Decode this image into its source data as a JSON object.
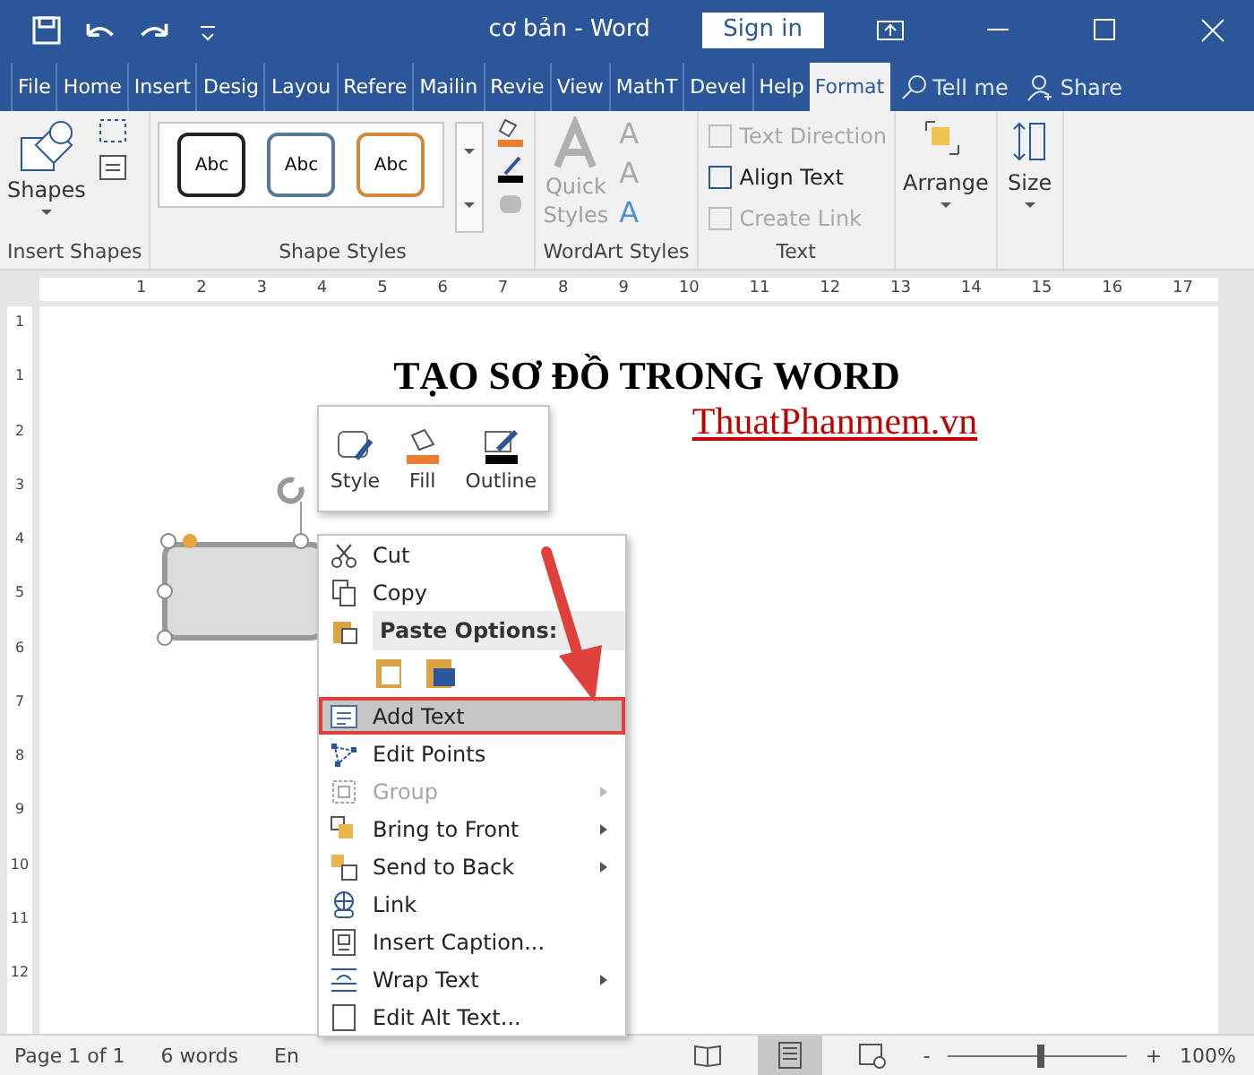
{
  "window": {
    "title": "cơ bản  -  Word",
    "sign_in": "Sign in"
  },
  "tabs": [
    {
      "label": "File",
      "selected": false
    },
    {
      "label": "Home",
      "selected": false
    },
    {
      "label": "Insert",
      "selected": false
    },
    {
      "label": "Desig",
      "selected": false
    },
    {
      "label": "Layou",
      "selected": false
    },
    {
      "label": "Refere",
      "selected": false
    },
    {
      "label": "Mailin",
      "selected": false
    },
    {
      "label": "Revie",
      "selected": false
    },
    {
      "label": "View",
      "selected": false
    },
    {
      "label": "MathT",
      "selected": false
    },
    {
      "label": "Devel",
      "selected": false
    },
    {
      "label": "Help",
      "selected": false
    },
    {
      "label": "Format",
      "selected": true
    }
  ],
  "tell_me": "Tell me",
  "share": "Share",
  "ribbon": {
    "insert_shapes": {
      "shapes": "Shapes",
      "label": "Insert Shapes"
    },
    "shape_styles": {
      "label": "Shape Styles",
      "items": [
        {
          "text": "Abc",
          "color": "#222222"
        },
        {
          "text": "Abc",
          "color": "#5a7896"
        },
        {
          "text": "Abc",
          "color": "#d08a3c"
        }
      ]
    },
    "wordart": {
      "label": "WordArt Styles",
      "quick": "Quick",
      "styles": "Styles",
      "letters": [
        "A",
        "A",
        "A"
      ]
    },
    "text": {
      "label": "Text",
      "items": [
        {
          "text": "Text Direction",
          "disabled": true
        },
        {
          "text": "Align Text",
          "disabled": false
        },
        {
          "text": "Create Link",
          "disabled": true
        }
      ]
    },
    "arrange": "Arrange",
    "size": "Size"
  },
  "ruler": [
    "1",
    "2",
    "3",
    "4",
    "5",
    "6",
    "7",
    "8",
    "9",
    "10",
    "11",
    "12",
    "13",
    "14",
    "15",
    "16",
    "17"
  ],
  "vruler": [
    "1",
    "1",
    "2",
    "3",
    "4",
    "5",
    "6",
    "7",
    "8",
    "9",
    "10",
    "11",
    "12"
  ],
  "document": {
    "heading": "TẠO SƠ ĐỒ TRONG WORD",
    "link": "ThuatPhanmem.vn"
  },
  "mini_toolbar": [
    {
      "kind": "style",
      "label": "Style"
    },
    {
      "kind": "fill",
      "label": "Fill"
    },
    {
      "kind": "outline",
      "label": "Outline"
    }
  ],
  "context_menu": [
    {
      "kind": "item",
      "label": "Cut",
      "disabled": false,
      "selected": false,
      "submenu": false
    },
    {
      "kind": "item",
      "label": "Copy",
      "disabled": false,
      "selected": false,
      "submenu": false
    },
    {
      "kind": "header",
      "label": "Paste Options:"
    },
    {
      "kind": "paste"
    },
    {
      "kind": "item",
      "label": "Add Text",
      "disabled": false,
      "selected": true,
      "submenu": false
    },
    {
      "kind": "item",
      "label": "Edit Points",
      "disabled": false,
      "selected": false,
      "submenu": false
    },
    {
      "kind": "item",
      "label": "Group",
      "disabled": true,
      "selected": false,
      "submenu": true
    },
    {
      "kind": "item",
      "label": "Bring to Front",
      "disabled": false,
      "selected": false,
      "submenu": true
    },
    {
      "kind": "item",
      "label": "Send to Back",
      "disabled": false,
      "selected": false,
      "submenu": true
    },
    {
      "kind": "item",
      "label": "Link",
      "disabled": false,
      "selected": false,
      "submenu": false
    },
    {
      "kind": "item",
      "label": "Insert Caption...",
      "disabled": false,
      "selected": false,
      "submenu": false
    },
    {
      "kind": "item",
      "label": "Wrap Text",
      "disabled": false,
      "selected": false,
      "submenu": true
    },
    {
      "kind": "item",
      "label": "Edit Alt Text...",
      "disabled": false,
      "selected": false,
      "submenu": false
    }
  ],
  "status_bar": {
    "page": "Page 1 of 1",
    "words": "6 words",
    "language": "En",
    "views": [
      {
        "kind": "read",
        "selected": false
      },
      {
        "kind": "print",
        "selected": true
      },
      {
        "kind": "web",
        "selected": false
      }
    ],
    "zoom_out": "-",
    "zoom_in": "+",
    "zoom": {
      "level": 0.52
    },
    "zoom_text": "100%"
  }
}
